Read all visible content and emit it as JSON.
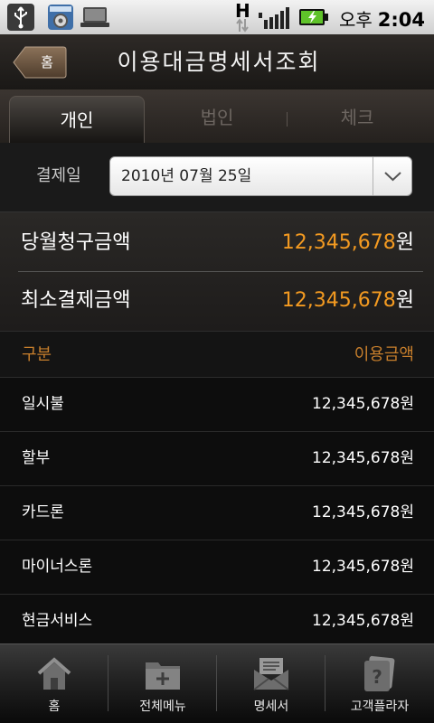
{
  "status_bar": {
    "network_label": "H",
    "ampm": "오후",
    "time": "2:04",
    "icons": [
      "usb-icon",
      "apps-icon",
      "laptop-icon",
      "network-arrows-icon",
      "signal-icon",
      "battery-charging-icon"
    ]
  },
  "header": {
    "back_label": "홈",
    "title": "이용대금명세서조회"
  },
  "tabs": [
    {
      "label": "개인",
      "selected": true
    },
    {
      "label": "법인",
      "selected": false
    },
    {
      "label": "체크",
      "selected": false
    }
  ],
  "date_filter": {
    "label": "결제일",
    "value": "2010년 07월 25일"
  },
  "summary": {
    "billing": {
      "label": "당월청구금액",
      "amount": "12,345,678",
      "unit": "원"
    },
    "minimum": {
      "label": "최소결제금액",
      "amount": "12,345,678",
      "unit": "원"
    }
  },
  "list": {
    "header_left": "구분",
    "header_right": "이용금액",
    "items": [
      {
        "label": "일시불",
        "amount": "12,345,678원"
      },
      {
        "label": "할부",
        "amount": "12,345,678원"
      },
      {
        "label": "카드론",
        "amount": "12,345,678원"
      },
      {
        "label": "마이너스론",
        "amount": "12,345,678원"
      },
      {
        "label": "현금서비스",
        "amount": "12,345,678원"
      }
    ]
  },
  "bottom_nav": [
    {
      "label": "홈",
      "icon": "home-icon"
    },
    {
      "label": "전체메뉴",
      "icon": "folder-plus-icon"
    },
    {
      "label": "명세서",
      "icon": "envelope-icon"
    },
    {
      "label": "고객플라자",
      "icon": "help-icon"
    }
  ],
  "colors": {
    "accent_orange": "#f39a21",
    "header_gold": "#c87f2c"
  }
}
